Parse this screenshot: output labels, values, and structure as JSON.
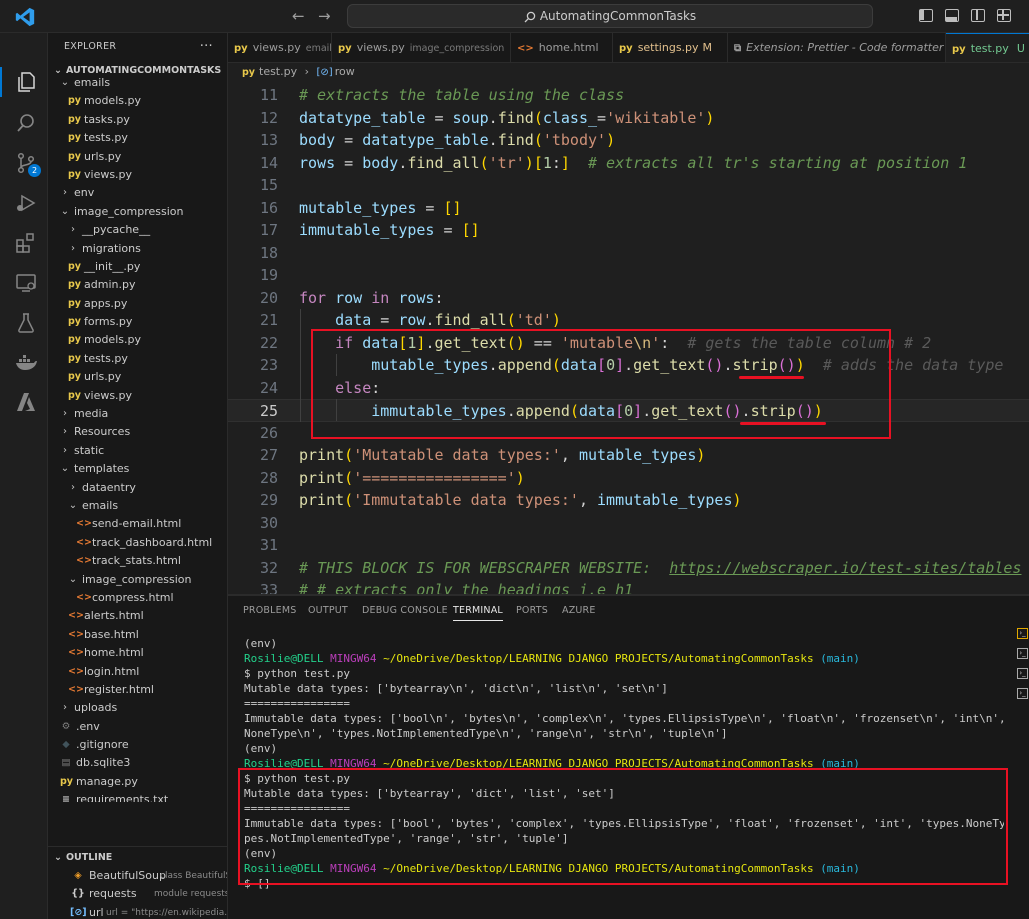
{
  "titlebar": {
    "search_text": "AutomatingCommonTasks",
    "logo": "vscode-logo",
    "back": "←",
    "forward": "→"
  },
  "activity_bar": {
    "items": [
      "explorer-icon",
      "search-icon",
      "source-control-icon",
      "run-debug-icon",
      "extensions-icon",
      "remote-explorer-icon",
      "testing-icon",
      "docker-icon",
      "azure-icon"
    ],
    "scm_badge": "2"
  },
  "explorer": {
    "header": "EXPLORER",
    "more": "···",
    "root": "AUTOMATINGCOMMONTASKS",
    "items": [
      {
        "label": "emails",
        "kind": "folder-open",
        "depth": 1
      },
      {
        "label": "models.py",
        "kind": "py",
        "depth": 2
      },
      {
        "label": "tasks.py",
        "kind": "py",
        "depth": 2
      },
      {
        "label": "tests.py",
        "kind": "py",
        "depth": 2
      },
      {
        "label": "urls.py",
        "kind": "py",
        "depth": 2
      },
      {
        "label": "views.py",
        "kind": "py",
        "depth": 2
      },
      {
        "label": "env",
        "kind": "folder",
        "depth": 1
      },
      {
        "label": "image_compression",
        "kind": "folder-open",
        "depth": 1
      },
      {
        "label": "__pycache__",
        "kind": "folder",
        "depth": 2
      },
      {
        "label": "migrations",
        "kind": "folder",
        "depth": 2
      },
      {
        "label": "__init__.py",
        "kind": "py",
        "depth": 2
      },
      {
        "label": "admin.py",
        "kind": "py",
        "depth": 2
      },
      {
        "label": "apps.py",
        "kind": "py",
        "depth": 2
      },
      {
        "label": "forms.py",
        "kind": "py",
        "depth": 2
      },
      {
        "label": "models.py",
        "kind": "py",
        "depth": 2
      },
      {
        "label": "tests.py",
        "kind": "py",
        "depth": 2
      },
      {
        "label": "urls.py",
        "kind": "py",
        "depth": 2
      },
      {
        "label": "views.py",
        "kind": "py",
        "depth": 2
      },
      {
        "label": "media",
        "kind": "folder",
        "depth": 1
      },
      {
        "label": "Resources",
        "kind": "folder",
        "depth": 1
      },
      {
        "label": "static",
        "kind": "folder",
        "depth": 1
      },
      {
        "label": "templates",
        "kind": "folder-open",
        "depth": 1
      },
      {
        "label": "dataentry",
        "kind": "folder",
        "depth": 2
      },
      {
        "label": "emails",
        "kind": "folder-open",
        "depth": 2
      },
      {
        "label": "send-email.html",
        "kind": "html",
        "depth": 3
      },
      {
        "label": "track_dashboard.html",
        "kind": "html",
        "depth": 3
      },
      {
        "label": "track_stats.html",
        "kind": "html",
        "depth": 3
      },
      {
        "label": "image_compression",
        "kind": "folder-open",
        "depth": 2
      },
      {
        "label": "compress.html",
        "kind": "html",
        "depth": 3
      },
      {
        "label": "alerts.html",
        "kind": "html",
        "depth": 2
      },
      {
        "label": "base.html",
        "kind": "html",
        "depth": 2
      },
      {
        "label": "home.html",
        "kind": "html",
        "depth": 2
      },
      {
        "label": "login.html",
        "kind": "html",
        "depth": 2
      },
      {
        "label": "register.html",
        "kind": "html",
        "depth": 2
      },
      {
        "label": "uploads",
        "kind": "folder",
        "depth": 1
      },
      {
        "label": ".env",
        "kind": "env",
        "depth": 1
      },
      {
        "label": ".gitignore",
        "kind": "git",
        "depth": 1
      },
      {
        "label": "db.sqlite3",
        "kind": "db",
        "depth": 1
      },
      {
        "label": "manage.py",
        "kind": "py",
        "depth": 1
      },
      {
        "label": "requirements.txt",
        "kind": "txt",
        "depth": 1
      },
      {
        "label": "test.py",
        "kind": "py",
        "depth": 1,
        "active": true,
        "badge": "U"
      }
    ],
    "outline": {
      "title": "OUTLINE",
      "items": [
        {
          "label": "BeautifulSoup",
          "desc": "class BeautifulSoup",
          "kind": "class"
        },
        {
          "label": "requests",
          "desc": "module requests",
          "kind": "module"
        },
        {
          "label": "url",
          "desc": "url = \"https://en.wikipedia.org",
          "kind": "var"
        }
      ]
    }
  },
  "tabs": [
    {
      "label": "views.py",
      "desc": "emails",
      "icon": "py"
    },
    {
      "label": "views.py",
      "desc": "image_compression",
      "icon": "py"
    },
    {
      "label": "home.html",
      "desc": "",
      "icon": "html"
    },
    {
      "label": "settings.py",
      "desc": "",
      "icon": "py",
      "modified": "M"
    },
    {
      "label": "Extension: Prettier - Code formatter",
      "desc": "",
      "icon": "ext"
    },
    {
      "label": "test.py",
      "desc": "",
      "icon": "py",
      "active": true,
      "badge": "U"
    }
  ],
  "breadcrumb": {
    "file": "test.py",
    "sep": "›",
    "symbol": "row"
  },
  "editor": {
    "line_numbers": [
      "11",
      "12",
      "13",
      "14",
      "15",
      "16",
      "17",
      "18",
      "19",
      "20",
      "21",
      "22",
      "23",
      "24",
      "25",
      "26",
      "27",
      "28",
      "29",
      "30",
      "31",
      "32"
    ],
    "current_line": "25"
  },
  "panel": {
    "tabs": [
      "PROBLEMS",
      "OUTPUT",
      "DEBUG CONSOLE",
      "TERMINAL",
      "PORTS",
      "AZURE"
    ],
    "active_tab": "TERMINAL",
    "terminal": {
      "env": "(env)",
      "user": "Rosilie@DELL",
      "shell": "MINGW64",
      "path": "~/OneDrive/Desktop/LEARNING DJANGO PROJECTS/AutomatingCommonTasks",
      "branch": "(main)",
      "cmd": "$ python test.py",
      "out1_mut": "Mutable data types: ['bytearray\\n', 'dict\\n', 'list\\n', 'set\\n']",
      "sep": "================",
      "out1_imm_a": "Immutable data types: ['bool\\n', 'bytes\\n', 'complex\\n', 'types.EllipsisType\\n', 'float\\n', 'frozenset\\n', 'int\\n', 'types.",
      "out1_imm_b": "NoneType\\n', 'types.NotImplementedType\\n', 'range\\n', 'str\\n', 'tuple\\n']",
      "out2_mut": "Mutable data types: ['bytearray', 'dict', 'list', 'set']",
      "out2_imm_a": "Immutable data types: ['bool', 'bytes', 'complex', 'types.EllipsisType', 'float', 'frozenset', 'int', 'types.NoneType', 'ty",
      "out2_imm_b": "pes.NotImplementedType', 'range', 'str', 'tuple']",
      "prompt": "$ []"
    }
  },
  "colors": {
    "annotation": "#e81123",
    "accent": "#0078d4",
    "untracked": "#73c991"
  }
}
